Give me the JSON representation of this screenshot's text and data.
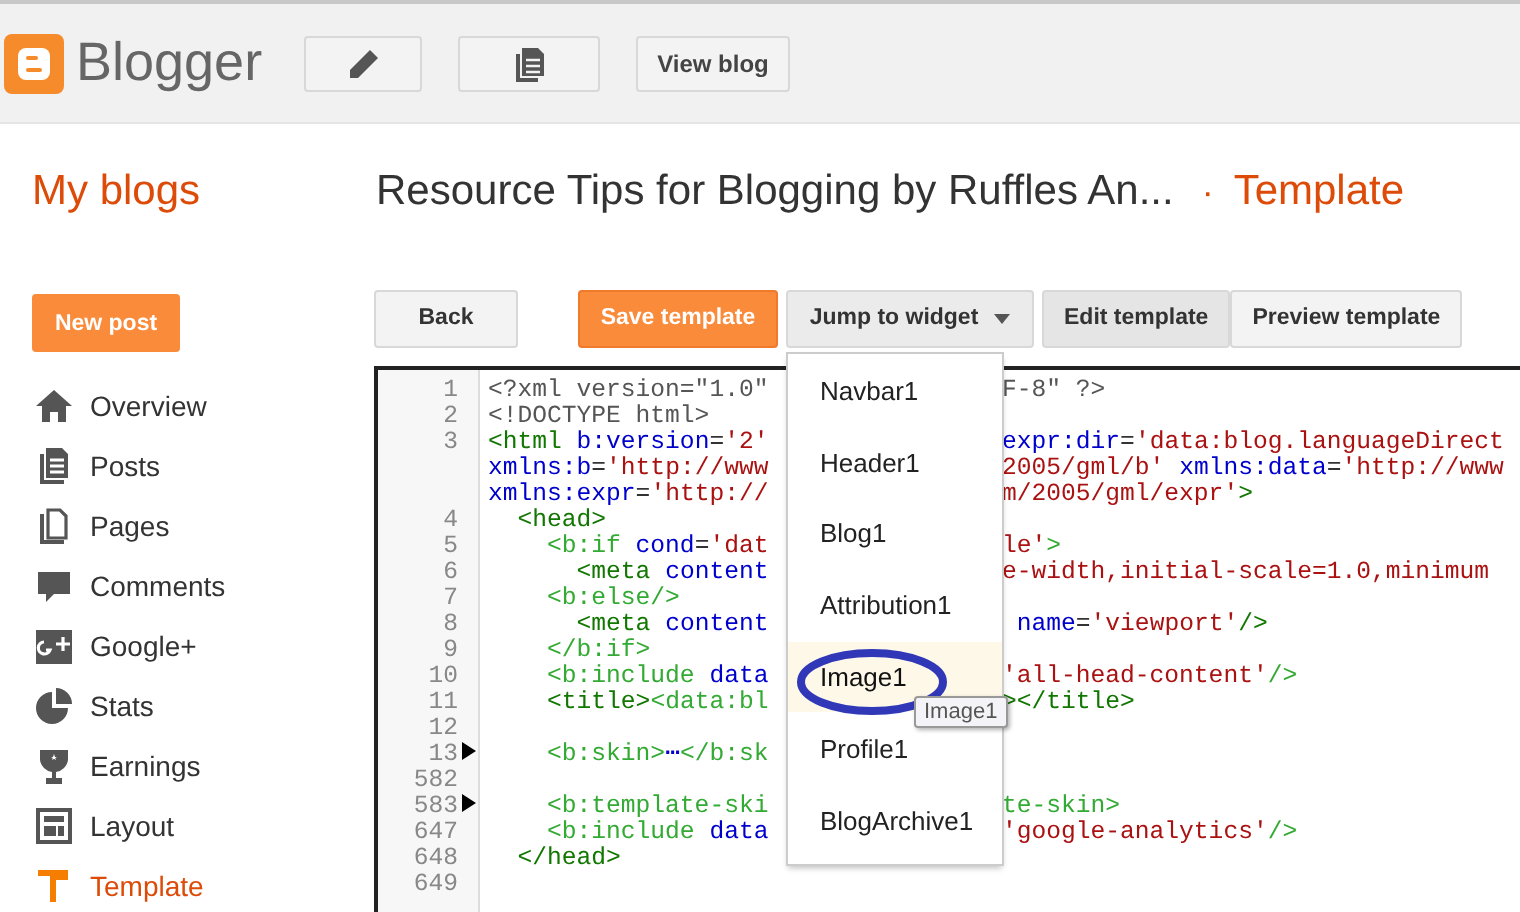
{
  "header": {
    "brand": "Blogger",
    "buttons": [
      {
        "kind": "icon"
      },
      {
        "kind": "icon"
      },
      {
        "kind": "text",
        "label": "View blog"
      }
    ]
  },
  "title_bar": {
    "my_blogs": "My blogs",
    "blog_title": "Resource Tips for Blogging by Ruffles An...",
    "separator": "·",
    "section": "Template"
  },
  "new_post": "New post",
  "sidebar": {
    "items": [
      {
        "label": "Overview",
        "selected": false
      },
      {
        "label": "Posts",
        "selected": false
      },
      {
        "label": "Pages",
        "selected": false
      },
      {
        "label": "Comments",
        "selected": false
      },
      {
        "label": "Google+",
        "selected": false
      },
      {
        "label": "Stats",
        "selected": false
      },
      {
        "label": "Earnings",
        "selected": false
      },
      {
        "label": "Layout",
        "selected": false
      },
      {
        "label": "Template",
        "selected": true
      }
    ]
  },
  "toolbar": {
    "back": "Back",
    "save": "Save template",
    "jump": "Jump to widget",
    "tabs": [
      {
        "label": "Edit template",
        "selected": true
      },
      {
        "label": "Preview template",
        "selected": false
      }
    ]
  },
  "editor": {
    "lines": [
      {
        "number": "1",
        "left": [
          {
            "kind": "decl",
            "text": "<?xml version=\"1.0\""
          }
        ],
        "right": [
          {
            "kind": "decl",
            "text": "F-8\" ?>"
          }
        ]
      },
      {
        "number": "2",
        "left": [
          {
            "kind": "decl",
            "text": "<!DOCTYPE html>"
          }
        ]
      },
      {
        "number": "3",
        "left": [
          {
            "kind": "tag",
            "text": "<html "
          },
          {
            "kind": "attr",
            "text": "b:version"
          },
          {
            "kind": "plain",
            "text": "="
          },
          {
            "kind": "val",
            "text": "'2'"
          }
        ],
        "right": [
          {
            "kind": "attr",
            "text": "expr:dir"
          },
          {
            "kind": "plain",
            "text": "="
          },
          {
            "kind": "val",
            "text": "'data:blog.languageDirect"
          }
        ]
      },
      {
        "left": [
          {
            "kind": "attr",
            "text": "xmlns:b"
          },
          {
            "kind": "plain",
            "text": "="
          },
          {
            "kind": "val",
            "text": "'http://www"
          }
        ],
        "right": [
          {
            "kind": "val",
            "text": "2005/gml/b'"
          },
          {
            "kind": "attr",
            "text": " xmlns:data"
          },
          {
            "kind": "plain",
            "text": "="
          },
          {
            "kind": "val",
            "text": "'http://www"
          }
        ]
      },
      {
        "left": [
          {
            "kind": "attr",
            "text": "xmlns:expr"
          },
          {
            "kind": "plain",
            "text": "="
          },
          {
            "kind": "val",
            "text": "'http://"
          }
        ],
        "right": [
          {
            "kind": "val",
            "text": "m/2005/gml/expr'"
          },
          {
            "kind": "tag",
            "text": ">"
          }
        ]
      },
      {
        "number": "4",
        "left": [
          {
            "kind": "tag",
            "text": "  <head>"
          }
        ]
      },
      {
        "number": "5",
        "left": [
          {
            "kind": "btag",
            "text": "    <b:if "
          },
          {
            "kind": "attr",
            "text": "cond"
          },
          {
            "kind": "plain",
            "text": "="
          },
          {
            "kind": "val",
            "text": "'dat"
          }
        ],
        "right": [
          {
            "kind": "val",
            "text": "le'"
          },
          {
            "kind": "btag",
            "text": ">"
          }
        ]
      },
      {
        "number": "6",
        "left": [
          {
            "kind": "tag",
            "text": "      <meta "
          },
          {
            "kind": "attr",
            "text": "content"
          }
        ],
        "right": [
          {
            "kind": "val",
            "text": "e-width,initial-scale=1.0,minimum"
          }
        ]
      },
      {
        "number": "7",
        "left": [
          {
            "kind": "btag",
            "text": "    <b:else/>"
          }
        ]
      },
      {
        "number": "8",
        "left": [
          {
            "kind": "tag",
            "text": "      <meta "
          },
          {
            "kind": "attr",
            "text": "content"
          }
        ],
        "right": [
          {
            "kind": "attr",
            "text": " name"
          },
          {
            "kind": "plain",
            "text": "="
          },
          {
            "kind": "val",
            "text": "'viewport'"
          },
          {
            "kind": "tag",
            "text": "/>"
          }
        ]
      },
      {
        "number": "9",
        "left": [
          {
            "kind": "btag",
            "text": "    </b:if>"
          }
        ]
      },
      {
        "number": "10",
        "left": [
          {
            "kind": "btag",
            "text": "    <b:include "
          },
          {
            "kind": "attr",
            "text": "data"
          }
        ],
        "right": [
          {
            "kind": "val",
            "text": "'all-head-content'"
          },
          {
            "kind": "btag",
            "text": "/>"
          }
        ]
      },
      {
        "number": "11",
        "left": [
          {
            "kind": "tag",
            "text": "    <title>"
          },
          {
            "kind": "btag",
            "text": "<data:bl"
          }
        ],
        "right": [
          {
            "kind": "tag",
            "text": "></title>"
          }
        ]
      },
      {
        "number": "12"
      },
      {
        "number": "13",
        "folded": true,
        "left": [
          {
            "kind": "btag",
            "text": "    <b:skin>"
          },
          {
            "kind": "fold",
            "text": "⋯"
          },
          {
            "kind": "btag",
            "text": "</b:sk"
          }
        ]
      },
      {
        "number": "582"
      },
      {
        "number": "583",
        "folded": true,
        "left": [
          {
            "kind": "btag",
            "text": "    <b:template-ski"
          }
        ],
        "right": [
          {
            "kind": "btag",
            "text": "te-skin>"
          }
        ]
      },
      {
        "number": "647",
        "left": [
          {
            "kind": "btag",
            "text": "    <b:include "
          },
          {
            "kind": "attr",
            "text": "data"
          }
        ],
        "right": [
          {
            "kind": "val",
            "text": "'google-analytics'"
          },
          {
            "kind": "btag",
            "text": "/>"
          }
        ]
      },
      {
        "number": "648",
        "left": [
          {
            "kind": "tag",
            "text": "  </head>"
          }
        ]
      },
      {
        "number": "649"
      }
    ]
  },
  "widget_menu": {
    "items": [
      {
        "label": "Navbar1",
        "selected": false,
        "circled": false
      },
      {
        "label": "Header1",
        "selected": false,
        "circled": false
      },
      {
        "label": "Blog1",
        "selected": false,
        "circled": false
      },
      {
        "label": "Attribution1",
        "selected": false,
        "circled": false
      },
      {
        "label": "Image1",
        "selected": true,
        "circled": true,
        "tooltip": "Image1"
      },
      {
        "label": "Profile1",
        "selected": false,
        "circled": false
      },
      {
        "label": "BlogArchive1",
        "selected": false,
        "circled": false
      }
    ]
  }
}
